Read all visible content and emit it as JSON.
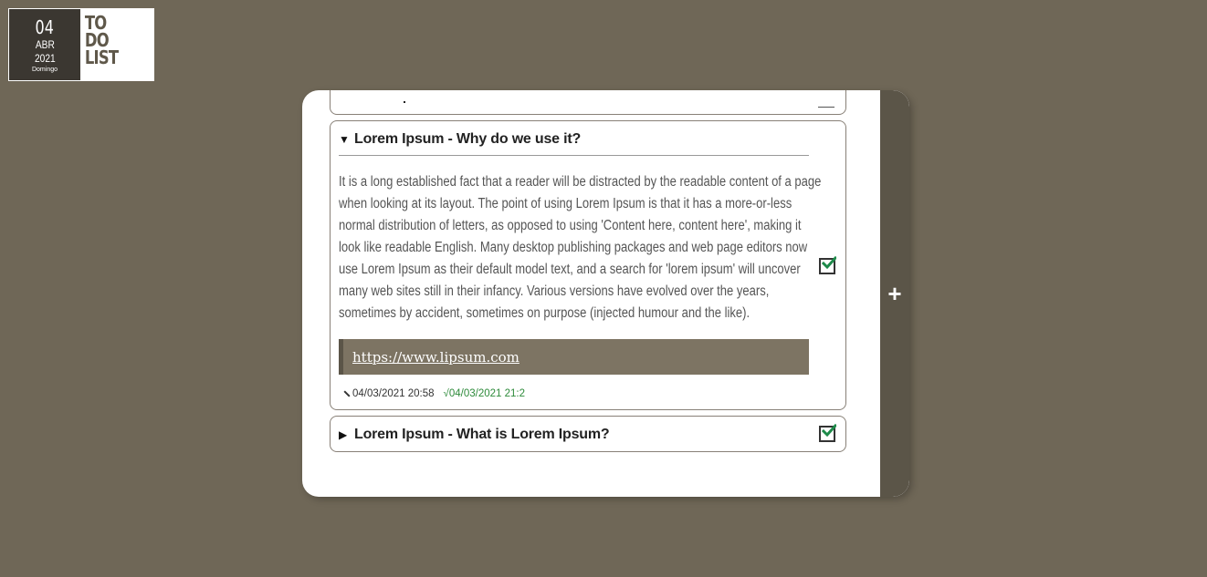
{
  "header": {
    "day": "04",
    "month": "ABR",
    "year": "2021",
    "weekday": "Domingo",
    "logo_lines": [
      "TO",
      "DO",
      "LIST"
    ]
  },
  "todos": [
    {
      "title": "Lorem Ipsum - Why do we use it?",
      "expanded": true,
      "checked": true,
      "body": "It is a long established fact that a reader will be distracted by the readable content of a page when looking at its layout. The point of using Lorem Ipsum is that it has a more-or-less normal distribution of letters, as opposed to using 'Content here, content here', making it look like readable English. Many desktop publishing packages and web page editors now use Lorem Ipsum as their default model text, and a search for 'lorem ipsum' will uncover many web sites still in their infancy. Various versions have evolved over the years, sometimes by accident, sometimes on purpose (injected humour and the like).",
      "link": "https://www.lipsum.com",
      "created": "04/03/2021 20:58",
      "completed": "√04/03/2021 21:2"
    },
    {
      "title": "Lorem Ipsum - What is Lorem Ipsum?",
      "expanded": false,
      "checked": true
    }
  ],
  "add_button": {
    "label": "+"
  },
  "colors": {
    "background": "#6f6757",
    "panel": "#5b5548",
    "link_box": "#7d7463",
    "check": "#1e8a4a",
    "completed_text": "#2d8a3a"
  }
}
